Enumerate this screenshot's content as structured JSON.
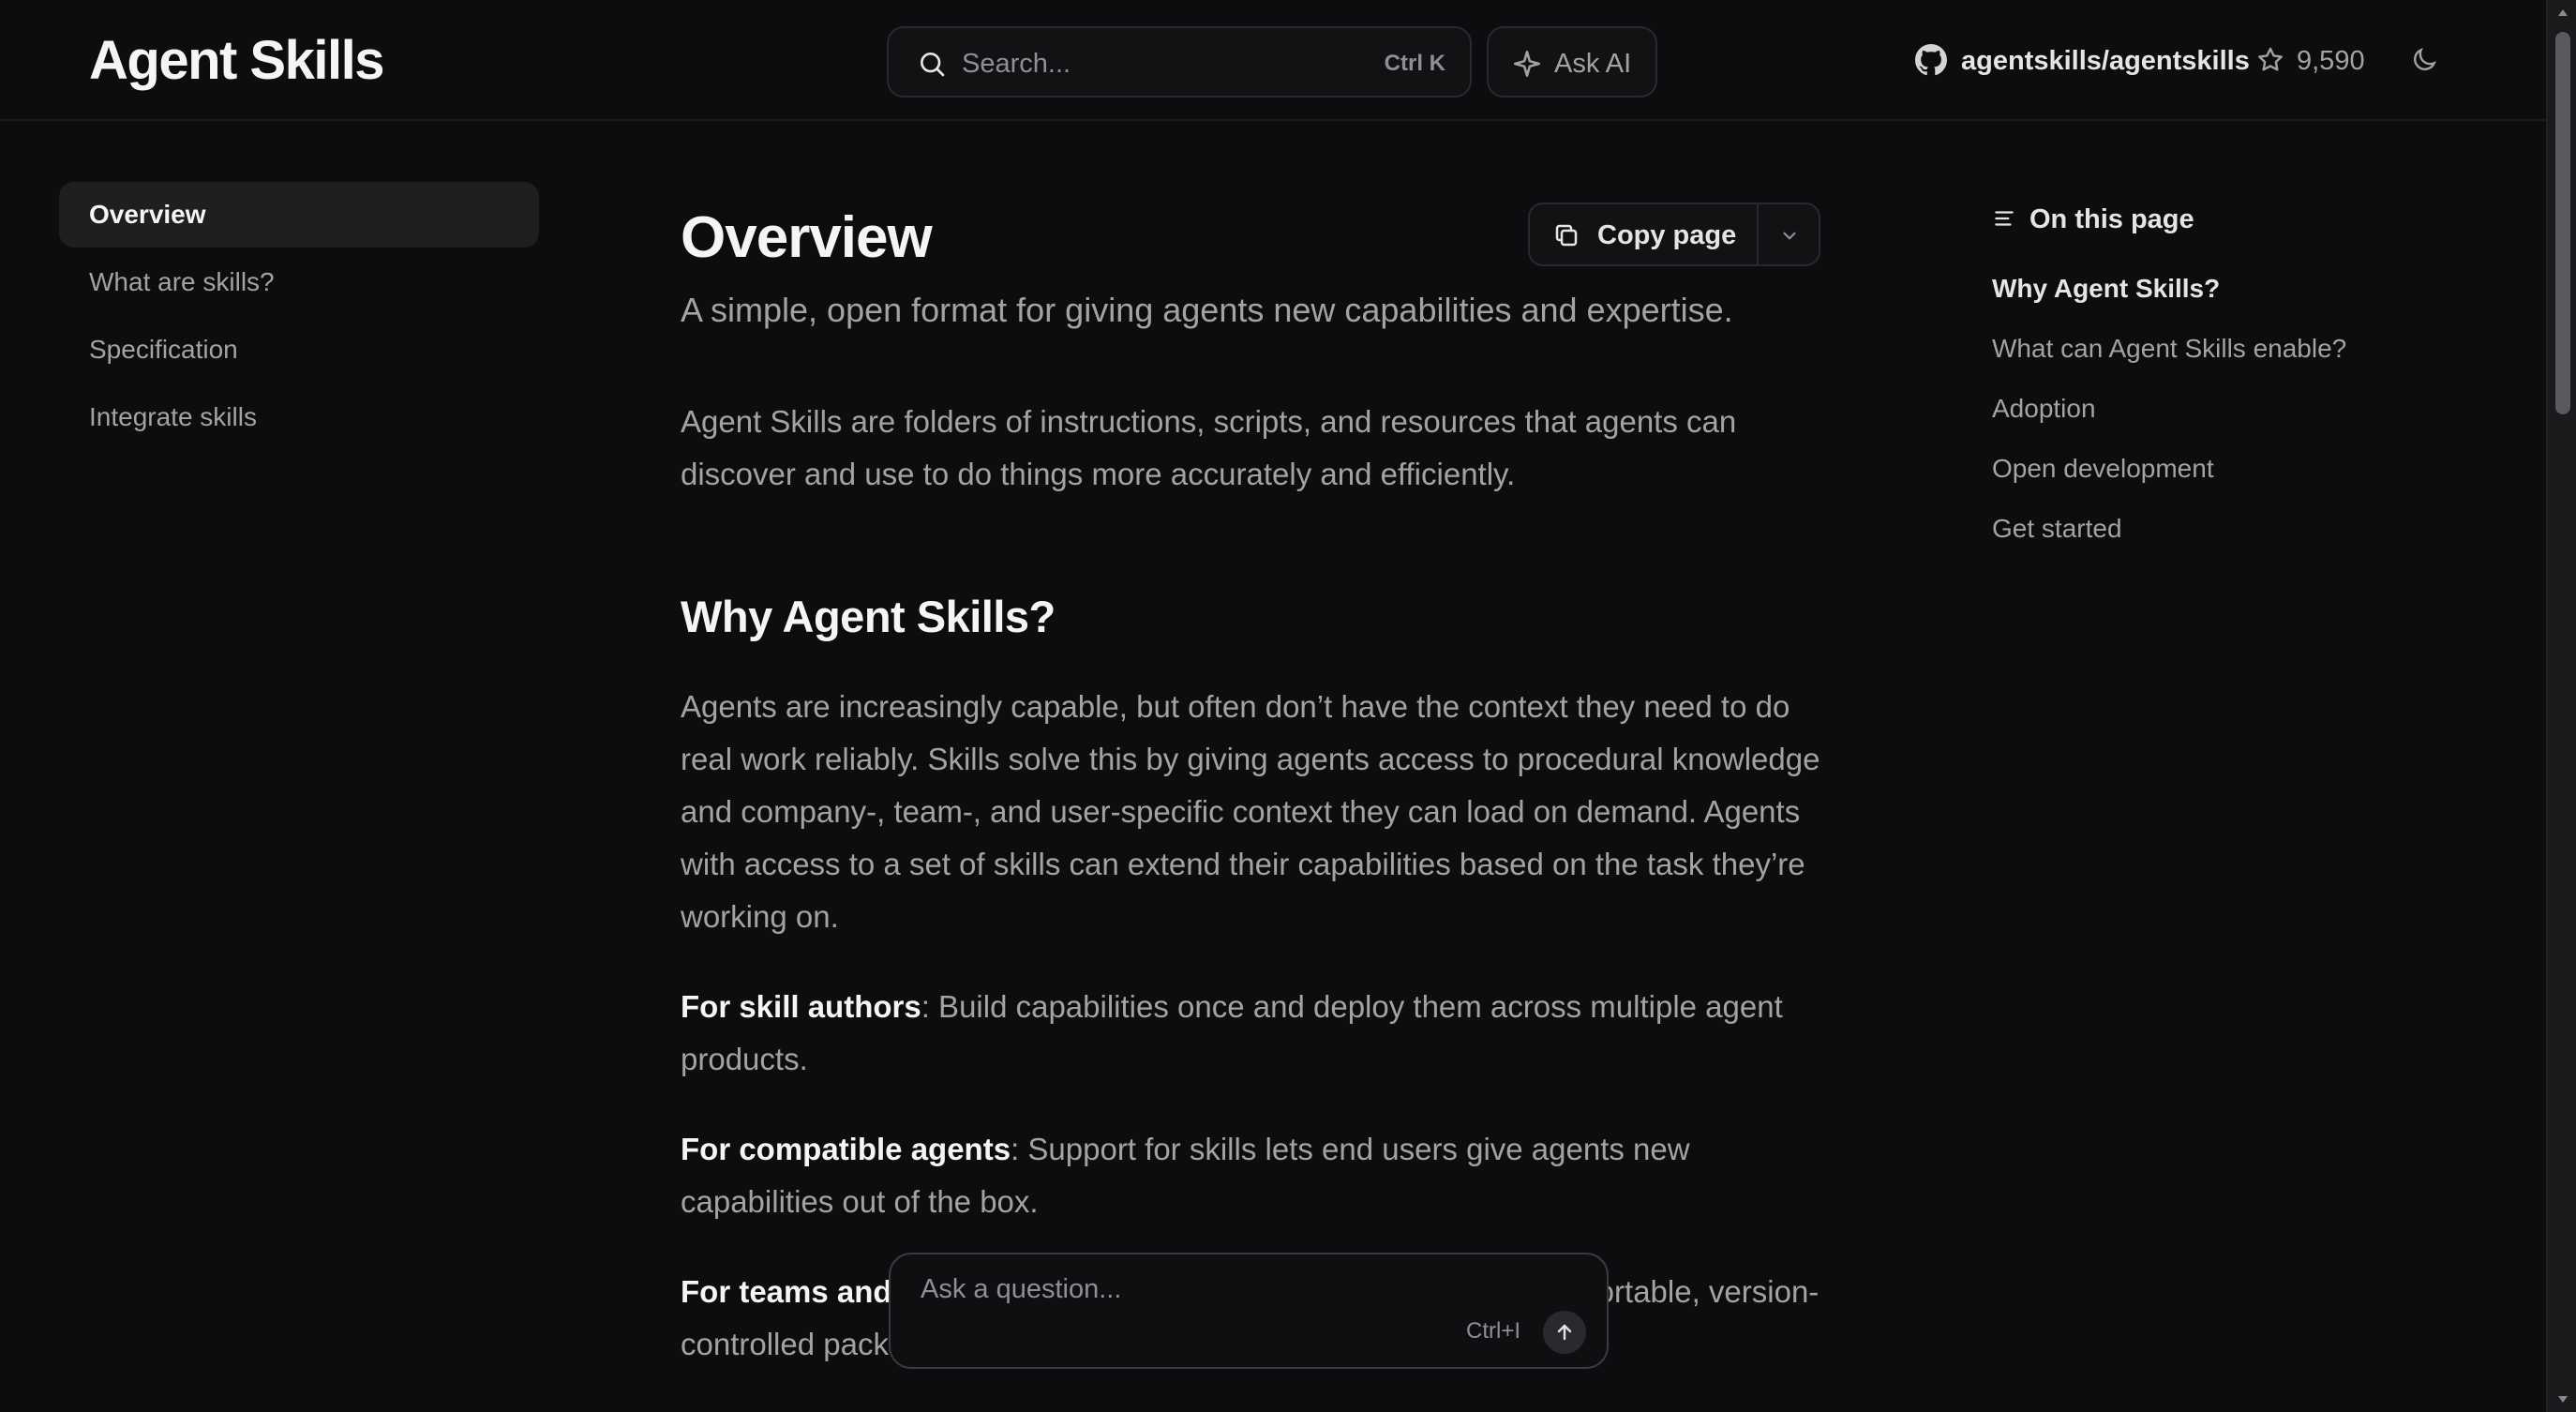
{
  "header": {
    "logo": "Agent Skills",
    "search_placeholder": "Search...",
    "search_shortcut": "Ctrl K",
    "ask_ai_label": "Ask AI",
    "repo": "agentskills/agentskills",
    "stars": "9,590"
  },
  "sidebar": {
    "items": [
      {
        "label": "Overview",
        "active": true
      },
      {
        "label": "What are skills?"
      },
      {
        "label": "Specification"
      },
      {
        "label": "Integrate skills"
      }
    ]
  },
  "main": {
    "title": "Overview",
    "copy_label": "Copy page",
    "subtitle": "A simple, open format for giving agents new capabilities and expertise.",
    "intro": "Agent Skills are folders of instructions, scripts, and resources that agents can discover and use to do things more accurately and efficiently.",
    "section_heading": "Why Agent Skills?",
    "para1": "Agents are increasingly capable, but often don’t have the context they need to do real work reliably. Skills solve this by giving agents access to procedural knowledge and company-, team-, and user-specific context they can load on demand. Agents with access to a set of skills can extend their capabilities based on the task they’re working on.",
    "bullets": [
      {
        "lead": "For skill authors",
        "text": ": Build capabilities once and deploy them across multiple agent products."
      },
      {
        "lead": "For compatible agents",
        "text": ": Support for skills lets end users give agents new capabilities out of the box."
      },
      {
        "lead": "For teams and",
        "text": " enterprises: Capture organizational knowledge in portable, version-controlled packages."
      }
    ]
  },
  "toc": {
    "title": "On this page",
    "items": [
      {
        "label": "Why Agent Skills?",
        "active": true
      },
      {
        "label": "What can Agent Skills enable?"
      },
      {
        "label": "Adoption"
      },
      {
        "label": "Open development"
      },
      {
        "label": "Get started"
      }
    ]
  },
  "ask": {
    "placeholder": "Ask a question...",
    "shortcut": "Ctrl+I"
  },
  "colors": {
    "background": "#0d0d0f",
    "text_muted": "#a3a3a3",
    "text_strong": "#f5f5f5",
    "border": "#2a2a2e"
  }
}
